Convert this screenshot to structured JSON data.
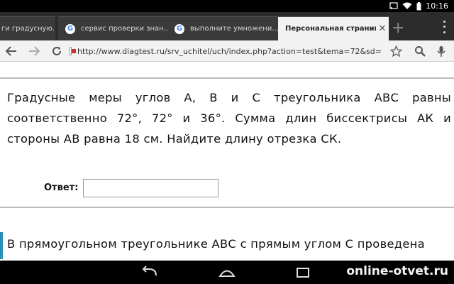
{
  "status_bar": {
    "time": "10:16"
  },
  "tabs": [
    {
      "title": "ги градусную...",
      "active": false
    },
    {
      "title": "сервис проверки знан...",
      "active": false,
      "favicon": "G"
    },
    {
      "title": "выполните умножени...",
      "active": false,
      "favicon": "G"
    },
    {
      "title": "Персональная страниц...",
      "active": true
    }
  ],
  "toolbar": {
    "url": "http://www.diagtest.ru/srv_uchitel/uch/index.php?action=test&tema=72&sd="
  },
  "content": {
    "question_text": "Градусные меры углов А, В и С треугольника АВС равны соответственно 72°, 72° и 36°. Сумма длин биссектрисы АК и стороны АВ равна 18 см. Найдите длину отрезка СК.",
    "answer_label": "Ответ:",
    "answer_value": "",
    "next_question_text": "В прямоугольном треугольнике АВС с прямым углом С проведена"
  },
  "watermark": "online-otvet.ru"
}
